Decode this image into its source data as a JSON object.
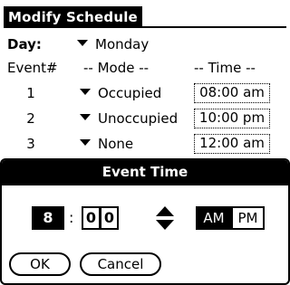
{
  "app": {
    "title": "Modify Schedule"
  },
  "day": {
    "label": "Day:",
    "value": "Monday"
  },
  "columns": {
    "event": "Event#",
    "mode": "-- Mode --",
    "time": "-- Time --"
  },
  "events": [
    {
      "num": "1",
      "mode": "Occupied",
      "time": "08:00 am"
    },
    {
      "num": "2",
      "mode": "Unoccupied",
      "time": "10:00 pm"
    },
    {
      "num": "3",
      "mode": "None",
      "time": "12:00 am"
    }
  ],
  "dialog": {
    "title": "Event Time",
    "hour": "8",
    "separator": ":",
    "minute_tens": "0",
    "minute_ones": "0",
    "am_label": "AM",
    "pm_label": "PM",
    "selected_period": "AM",
    "ok_label": "OK",
    "cancel_label": "Cancel"
  },
  "icons": {
    "dropdown": "triangle-down-icon",
    "spinner_up": "triangle-up-icon",
    "spinner_down": "triangle-down-icon"
  }
}
